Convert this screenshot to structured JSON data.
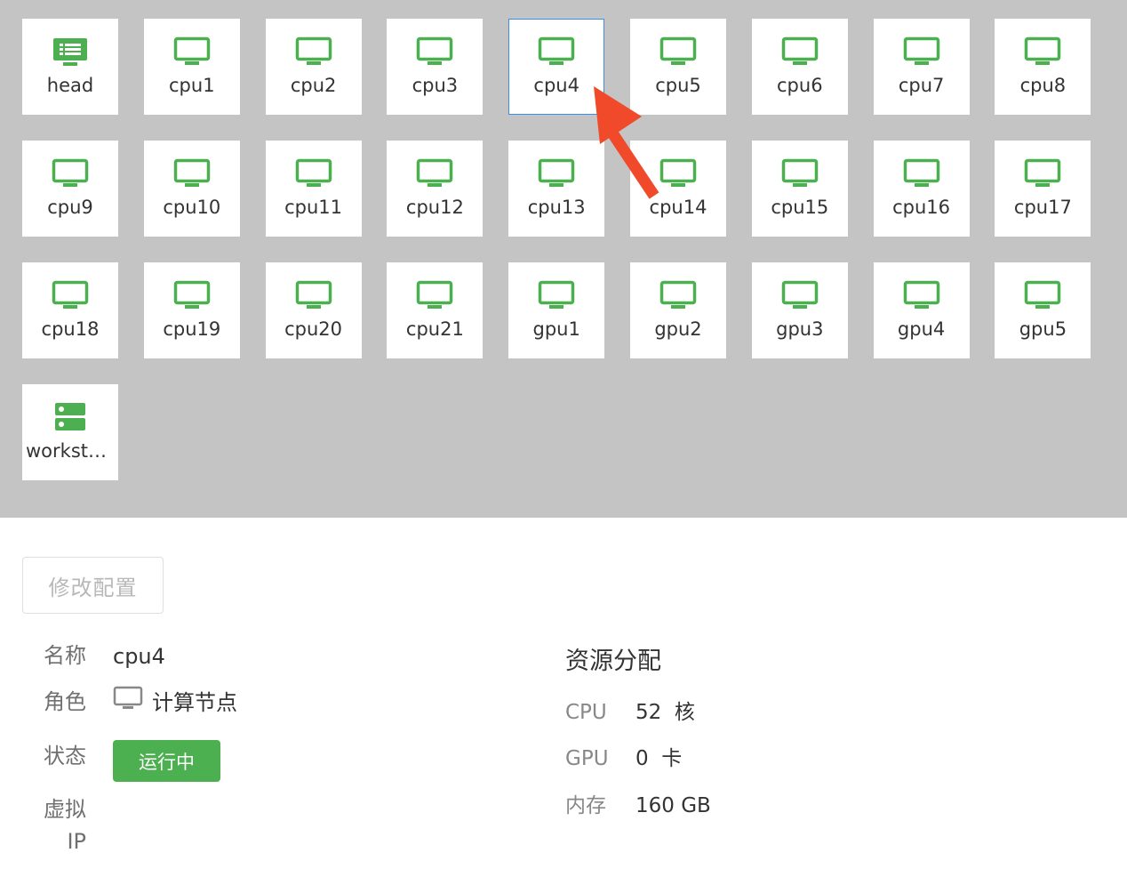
{
  "nodes": [
    {
      "label": "head",
      "icon": "list-monitor-icon",
      "selected": false
    },
    {
      "label": "cpu1",
      "icon": "monitor-icon",
      "selected": false
    },
    {
      "label": "cpu2",
      "icon": "monitor-icon",
      "selected": false
    },
    {
      "label": "cpu3",
      "icon": "monitor-icon",
      "selected": false
    },
    {
      "label": "cpu4",
      "icon": "monitor-icon",
      "selected": true
    },
    {
      "label": "cpu5",
      "icon": "monitor-icon",
      "selected": false
    },
    {
      "label": "cpu6",
      "icon": "monitor-icon",
      "selected": false
    },
    {
      "label": "cpu7",
      "icon": "monitor-icon",
      "selected": false
    },
    {
      "label": "cpu8",
      "icon": "monitor-icon",
      "selected": false
    },
    {
      "label": "cpu9",
      "icon": "monitor-icon",
      "selected": false
    },
    {
      "label": "cpu10",
      "icon": "monitor-icon",
      "selected": false
    },
    {
      "label": "cpu11",
      "icon": "monitor-icon",
      "selected": false
    },
    {
      "label": "cpu12",
      "icon": "monitor-icon",
      "selected": false
    },
    {
      "label": "cpu13",
      "icon": "monitor-icon",
      "selected": false
    },
    {
      "label": "cpu14",
      "icon": "monitor-icon",
      "selected": false
    },
    {
      "label": "cpu15",
      "icon": "monitor-icon",
      "selected": false
    },
    {
      "label": "cpu16",
      "icon": "monitor-icon",
      "selected": false
    },
    {
      "label": "cpu17",
      "icon": "monitor-icon",
      "selected": false
    },
    {
      "label": "cpu18",
      "icon": "monitor-icon",
      "selected": false
    },
    {
      "label": "cpu19",
      "icon": "monitor-icon",
      "selected": false
    },
    {
      "label": "cpu20",
      "icon": "monitor-icon",
      "selected": false
    },
    {
      "label": "cpu21",
      "icon": "monitor-icon",
      "selected": false
    },
    {
      "label": "gpu1",
      "icon": "monitor-icon",
      "selected": false
    },
    {
      "label": "gpu2",
      "icon": "monitor-icon",
      "selected": false
    },
    {
      "label": "gpu3",
      "icon": "monitor-icon",
      "selected": false
    },
    {
      "label": "gpu4",
      "icon": "monitor-icon",
      "selected": false
    },
    {
      "label": "gpu5",
      "icon": "monitor-icon",
      "selected": false
    },
    {
      "label": "worksta...",
      "icon": "server-icon",
      "selected": false
    }
  ],
  "colors": {
    "icon_green": "#4caf50",
    "selected_border": "#3a8ee6",
    "arrow": "#f04a2a",
    "grid_background": "#c4c4c4"
  },
  "toolbar": {
    "edit_config_label": "修改配置"
  },
  "details": {
    "name_label": "名称",
    "name_value": "cpu4",
    "role_label": "角色",
    "role_value": "计算节点",
    "role_icon": "monitor-icon",
    "status_label": "状态",
    "status_value": "运行中",
    "vip_label_line1": "虚拟",
    "vip_label_line2": "IP"
  },
  "resources": {
    "title": "资源分配",
    "cpu_label": "CPU",
    "cpu_value": "52  核",
    "gpu_label": "GPU",
    "gpu_value": "0  卡",
    "memory_label": "内存",
    "memory_value": "160 GB"
  }
}
